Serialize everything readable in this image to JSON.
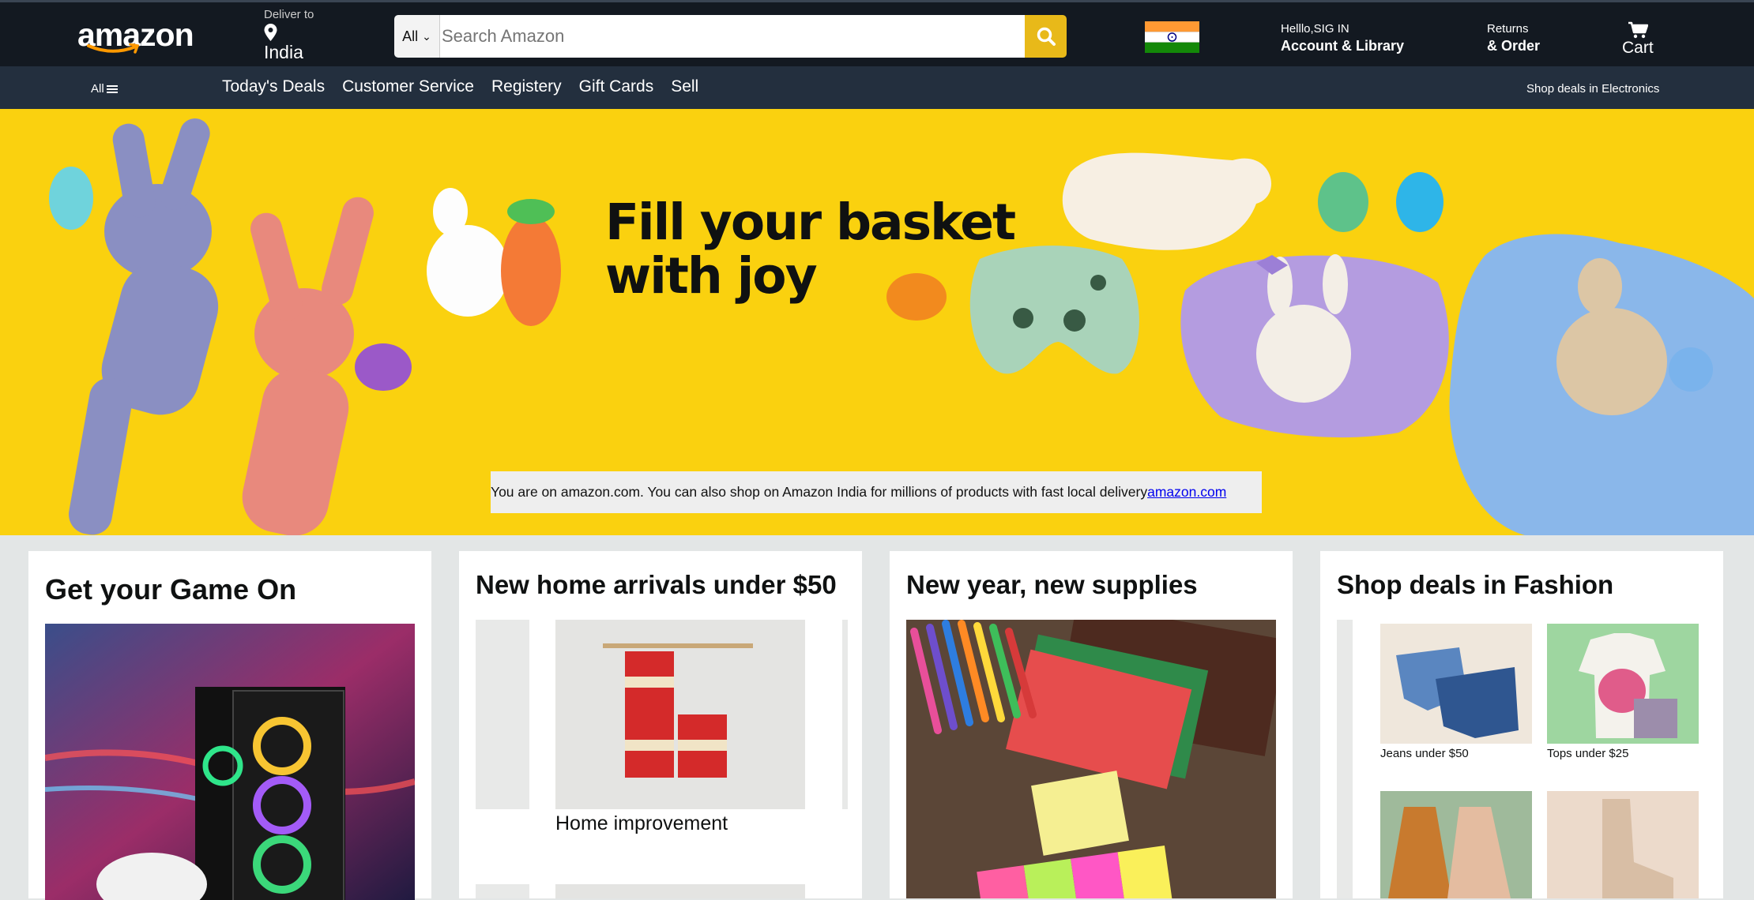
{
  "header": {
    "logo_text": "amazon",
    "deliver_small": "Deliver to",
    "deliver_country": "India",
    "search_dept": "All",
    "search_placeholder": "Search Amazon",
    "account_small": "Helllo,SIG IN",
    "account_big": "Account & Library",
    "returns_small": "Returns",
    "returns_big": "& Order",
    "cart_label": "Cart"
  },
  "nav": {
    "all_label": "All",
    "links": [
      "Today's Deals",
      "Customer Service",
      "Registery",
      "Gift Cards",
      "Sell"
    ],
    "right_label": "Shop deals in Electronics"
  },
  "hero": {
    "headline_line1": "Fill your basket",
    "headline_line2": "with joy",
    "notice_text": "You are on amazon.com. You can also shop on Amazon India for millions of products with fast local delivery",
    "notice_link": "amazon.com"
  },
  "cards": [
    {
      "title": "Get your Game On"
    },
    {
      "title": "New home arrivals under $50",
      "tile_caption": "Home improvement"
    },
    {
      "title": "New year, new supplies"
    },
    {
      "title": "Shop deals in Fashion",
      "tiles": [
        {
          "caption": "Jeans under $50"
        },
        {
          "caption": "Tops under $25"
        }
      ]
    }
  ],
  "colors": {
    "header_bg": "#131921",
    "nav_bg": "#232f3e",
    "hero_bg": "#fad10f",
    "search_button": "#e8b919",
    "page_bg": "#e3e6e6"
  }
}
